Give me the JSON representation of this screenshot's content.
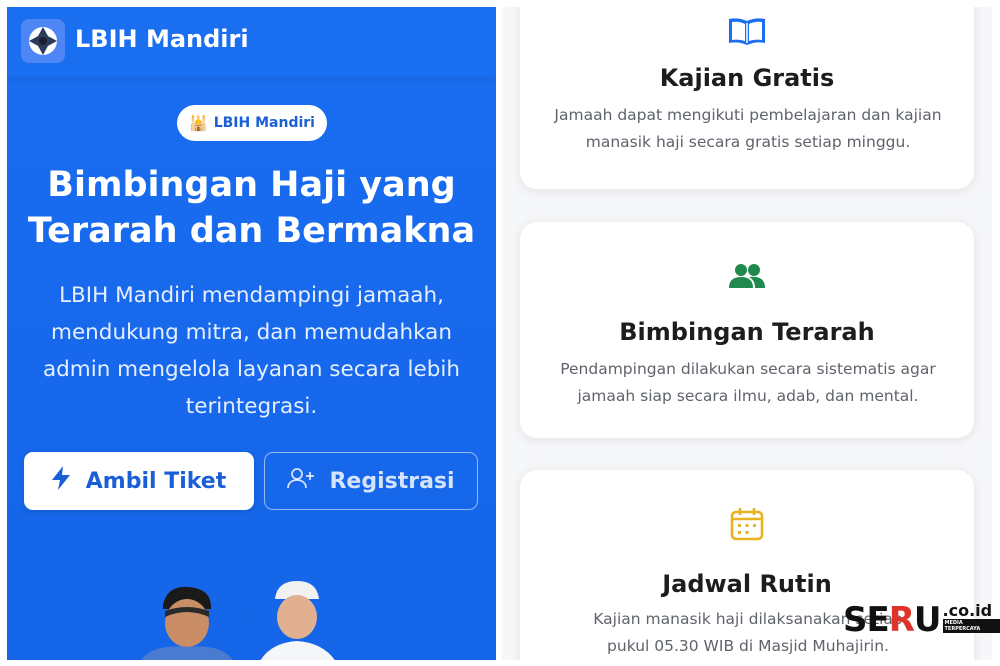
{
  "header": {
    "brand": "LBIH Mandiri",
    "logo_icon": "lens-logo-icon"
  },
  "hero": {
    "badge_icon": "mosque-icon",
    "badge_label": "LBIH Mandiri",
    "title": "Bimbingan Haji yang Terarah dan Bermakna",
    "description": "LBIH Mandiri mendampingi jamaah, mendukung mitra, dan memudahkan admin mengelola layanan secara lebih terintegrasi.",
    "primary_button": {
      "label": "Ambil Tiket",
      "icon": "lightning-icon"
    },
    "secondary_button": {
      "label": "Registrasi",
      "icon": "user-plus-icon"
    }
  },
  "features": [
    {
      "icon": "book-icon",
      "title": "Kajian Gratis",
      "description": "Jamaah dapat mengikuti pembelajaran dan kajian manasik haji secara gratis setiap minggu."
    },
    {
      "icon": "users-icon",
      "title": "Bimbingan Terarah",
      "description": "Pendampingan dilakukan secara sistematis agar jamaah siap secara ilmu, adab, dan mental."
    },
    {
      "icon": "calendar-icon",
      "title": "Jadwal Rutin",
      "description_line1": "Kajian manasik haji dilaksanakan setiap",
      "description_line2": "pukul 05.30 WIB di Masjid Muhajirin."
    }
  ],
  "watermark": {
    "se": "SE",
    "r": "R",
    "u": "U",
    "tld": ".co.id",
    "tag": "MEDIA TERPERCAYA"
  },
  "colors": {
    "primary": "#1a6ef0",
    "book_icon": "#1a6ef0",
    "users_icon": "#1f8a4c",
    "calendar_icon": "#e8b320",
    "text_dark": "#1d1d1f",
    "text_muted": "#5f636b"
  }
}
